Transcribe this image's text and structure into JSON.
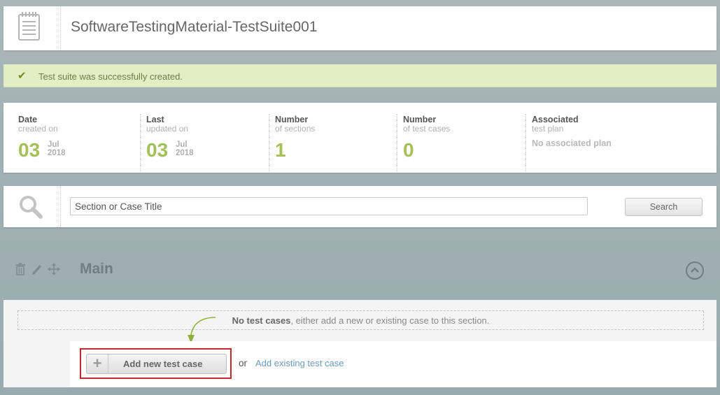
{
  "header": {
    "title": "SoftwareTestingMaterial-TestSuite001",
    "icon": "notepad-icon"
  },
  "banner": {
    "icon": "check-icon",
    "message": "Test suite was successfully created."
  },
  "stats": [
    {
      "label": "Date",
      "sub": "created on",
      "value": "03",
      "month": "Jul",
      "year": "2018"
    },
    {
      "label": "Last",
      "sub": "updated on",
      "value": "03",
      "month": "Jul",
      "year": "2018"
    },
    {
      "label": "Number",
      "sub": "of sections",
      "value": "1"
    },
    {
      "label": "Number",
      "sub": "of test cases",
      "value": "0"
    },
    {
      "label": "Associated",
      "sub": "test plan",
      "plan_text": "No associated plan"
    }
  ],
  "search": {
    "icon": "search-icon",
    "placeholder": "Section or Case Title",
    "button_label": "Search"
  },
  "section": {
    "title": "Main",
    "tools": [
      "trash-icon",
      "pencil-icon",
      "move-icon"
    ],
    "collapse_icon": "chevron-up-icon",
    "empty_bold": "No test cases",
    "empty_rest": ", either add a new or existing case to this section.",
    "add_button_label": "Add new test case",
    "add_button_icon": "plus-icon",
    "or_text": "or",
    "add_existing_label": "Add existing test case"
  },
  "colors": {
    "accent_green": "#a6c058",
    "banner_bg": "#e2efc4",
    "highlight_red": "#c8262c",
    "link_blue": "#6a9ac0"
  }
}
